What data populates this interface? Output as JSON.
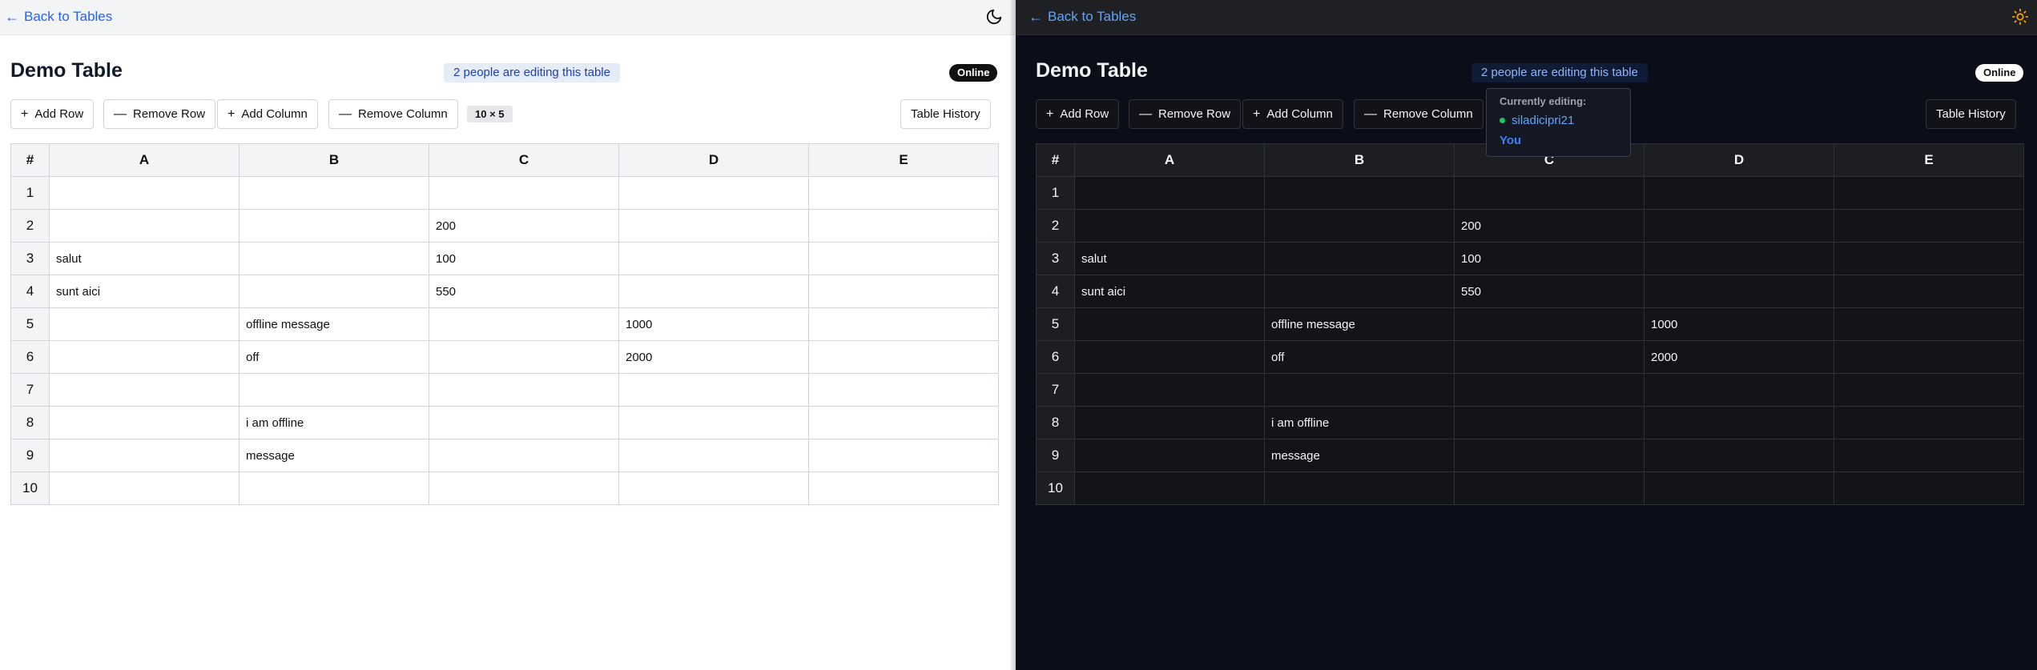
{
  "back_label": "Back to Tables",
  "table_title": "Demo Table",
  "editing_status": "2 people are editing this table",
  "online_label": "Online",
  "buttons": {
    "add_row": "Add Row",
    "remove_row": "Remove Row",
    "add_column": "Add Column",
    "remove_column": "Remove Column",
    "table_history": "Table History"
  },
  "dimensions": "10 × 5",
  "columns": [
    "#",
    "A",
    "B",
    "C",
    "D",
    "E"
  ],
  "rows": [
    {
      "num": "1",
      "cells": [
        "",
        "",
        "",
        "",
        ""
      ]
    },
    {
      "num": "2",
      "cells": [
        "",
        "",
        "200",
        "",
        ""
      ]
    },
    {
      "num": "3",
      "cells": [
        "salut",
        "",
        "100",
        "",
        ""
      ]
    },
    {
      "num": "4",
      "cells": [
        "sunt aici",
        "",
        "550",
        "",
        ""
      ]
    },
    {
      "num": "5",
      "cells": [
        "",
        "offline message",
        "",
        "1000",
        ""
      ]
    },
    {
      "num": "6",
      "cells": [
        "",
        "off",
        "",
        "2000",
        ""
      ]
    },
    {
      "num": "7",
      "cells": [
        "",
        "",
        "",
        "",
        ""
      ]
    },
    {
      "num": "8",
      "cells": [
        "",
        "i am offline",
        "",
        "",
        ""
      ]
    },
    {
      "num": "9",
      "cells": [
        "",
        "message",
        "",
        "",
        ""
      ]
    },
    {
      "num": "10",
      "cells": [
        "",
        "",
        "",
        "",
        ""
      ]
    }
  ],
  "popover": {
    "title": "Currently editing:",
    "user": "siladicipri21",
    "you": "You"
  },
  "icons": {
    "light_theme_toggle": "moon-icon",
    "dark_theme_toggle": "sun-icon"
  },
  "colors": {
    "link_light": "#2563eb",
    "link_dark": "#60a5fa",
    "online_dot": "#22c55e",
    "sun": "#f59e0b"
  }
}
